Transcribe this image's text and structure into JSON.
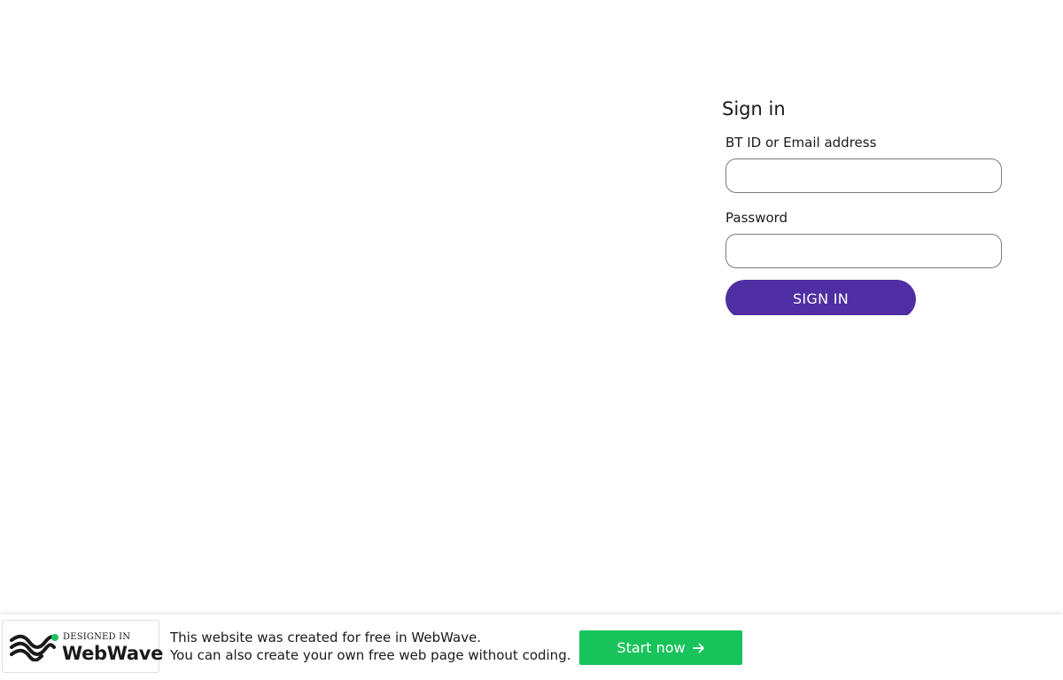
{
  "signin": {
    "title": "Sign in",
    "id_label": "BT ID or Email address",
    "id_value": "",
    "password_label": "Password",
    "password_value": "",
    "submit_label": "SIGN IN"
  },
  "banner": {
    "logo_small": "DESIGNED IN",
    "logo_big": "WebWave",
    "line1": "This website was created for free in WebWave.",
    "line2": "You can also create your own free web page without coding.",
    "cta_label": "Start now",
    "cta_icon": "arrow-right-icon"
  },
  "colors": {
    "signin_button": "#4f2ea3",
    "cta_button": "#19c35b",
    "logo_accent": "#19c35b"
  }
}
